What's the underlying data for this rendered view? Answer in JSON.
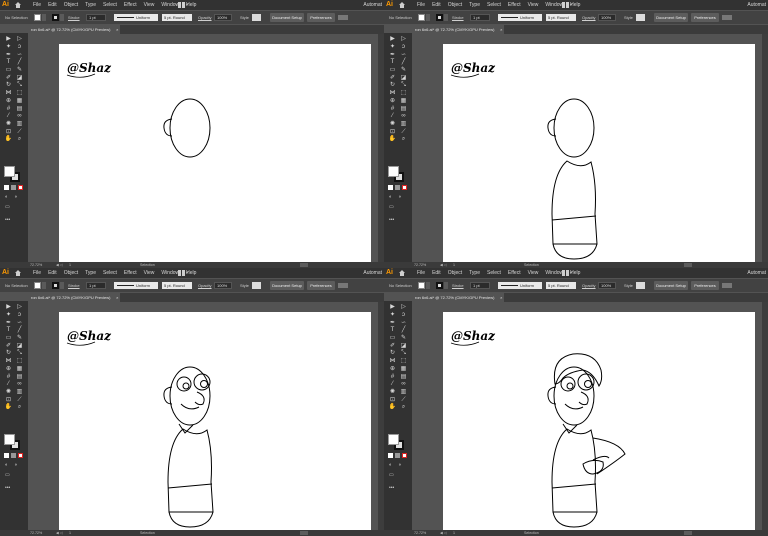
{
  "panels": [
    {
      "menubar": {
        "logo": "Ai",
        "menus": [
          "File",
          "Edit",
          "Object",
          "Type",
          "Select",
          "Effect",
          "View",
          "Window",
          "Help"
        ],
        "workspace": "Automat"
      },
      "control_bar": {
        "selection": "No Selection",
        "stroke_label": "Stroke",
        "stroke_weight": "1 pt",
        "profile": "Uniform",
        "brush": "5 pt. Round",
        "opacity_label": "Opacity",
        "opacity": "100%",
        "style_label": "Style",
        "doc_setup": "Document Setup",
        "preferences": "Preferences"
      },
      "tab": {
        "title": "ron 6x6.ai* @ 72.72% (CMYK/GPU Preview)",
        "close": "×"
      },
      "status": {
        "zoom": "72.72%",
        "page": "1",
        "mode": "Selection"
      },
      "signature": "@Shaz"
    },
    {
      "menubar": {
        "logo": "Ai",
        "menus": [
          "File",
          "Edit",
          "Object",
          "Type",
          "Select",
          "Effect",
          "View",
          "Window",
          "Help"
        ],
        "workspace": "Automat"
      },
      "control_bar": {
        "selection": "No Selection",
        "stroke_label": "Stroke",
        "stroke_weight": "1 pt",
        "profile": "Uniform",
        "brush": "5 pt. Round",
        "opacity_label": "Opacity",
        "opacity": "100%",
        "style_label": "Style",
        "doc_setup": "Document Setup",
        "preferences": "Preferences"
      },
      "tab": {
        "title": "ron 6x6.ai* @ 72.72% (CMYK/GPU Preview)",
        "close": "×"
      },
      "status": {
        "zoom": "72.72%",
        "page": "1",
        "mode": "Selection"
      },
      "signature": "@Shaz"
    },
    {
      "menubar": {
        "logo": "Ai",
        "menus": [
          "File",
          "Edit",
          "Object",
          "Type",
          "Select",
          "Effect",
          "View",
          "Window",
          "Help"
        ],
        "workspace": "Automat"
      },
      "control_bar": {
        "selection": "No Selection",
        "stroke_label": "Stroke",
        "stroke_weight": "1 pt",
        "profile": "Uniform",
        "brush": "5 pt. Round",
        "opacity_label": "Opacity",
        "opacity": "100%",
        "style_label": "Style",
        "doc_setup": "Document Setup",
        "preferences": "Preferences"
      },
      "tab": {
        "title": "ron 6x6.ai* @ 72.72% (CMYK/GPU Preview)",
        "close": "×"
      },
      "status": {
        "zoom": "72.72%",
        "page": "1",
        "mode": "Selection"
      },
      "signature": "@Shaz"
    },
    {
      "menubar": {
        "logo": "Ai",
        "menus": [
          "File",
          "Edit",
          "Object",
          "Type",
          "Select",
          "Effect",
          "View",
          "Window",
          "Help"
        ],
        "workspace": "Automat"
      },
      "control_bar": {
        "selection": "No Selection",
        "stroke_label": "Stroke",
        "stroke_weight": "1 pt",
        "profile": "Uniform",
        "brush": "5 pt. Round",
        "opacity_label": "Opacity",
        "opacity": "100%",
        "style_label": "Style",
        "doc_setup": "Document Setup",
        "preferences": "Preferences"
      },
      "tab": {
        "title": "ron 6x6.ai* @ 72.72% (CMYK/GPU Preview)",
        "close": "×"
      },
      "status": {
        "zoom": "72.72%",
        "page": "1",
        "mode": "Selection"
      },
      "signature": "@Shaz"
    }
  ],
  "tools": [
    {
      "icon": "selection-tool-icon",
      "glyph": "▶"
    },
    {
      "icon": "direct-selection-tool-icon",
      "glyph": "▷"
    },
    {
      "icon": "magic-wand-tool-icon",
      "glyph": "✦"
    },
    {
      "icon": "lasso-tool-icon",
      "glyph": "ↄ"
    },
    {
      "icon": "pen-tool-icon",
      "glyph": "✒"
    },
    {
      "icon": "curvature-tool-icon",
      "glyph": "∽"
    },
    {
      "icon": "type-tool-icon",
      "glyph": "T"
    },
    {
      "icon": "line-tool-icon",
      "glyph": "╱"
    },
    {
      "icon": "rectangle-tool-icon",
      "glyph": "▭"
    },
    {
      "icon": "paintbrush-tool-icon",
      "glyph": "✎"
    },
    {
      "icon": "shaper-tool-icon",
      "glyph": "✐"
    },
    {
      "icon": "eraser-tool-icon",
      "glyph": "◪"
    },
    {
      "icon": "rotate-tool-icon",
      "glyph": "↻"
    },
    {
      "icon": "scale-tool-icon",
      "glyph": "⤡"
    },
    {
      "icon": "width-tool-icon",
      "glyph": "⋈"
    },
    {
      "icon": "free-transform-tool-icon",
      "glyph": "⬚"
    },
    {
      "icon": "shape-builder-tool-icon",
      "glyph": "⊕"
    },
    {
      "icon": "perspective-grid-tool-icon",
      "glyph": "▦"
    },
    {
      "icon": "mesh-tool-icon",
      "glyph": "#"
    },
    {
      "icon": "gradient-tool-icon",
      "glyph": "▤"
    },
    {
      "icon": "eyedropper-tool-icon",
      "glyph": "⁄"
    },
    {
      "icon": "blend-tool-icon",
      "glyph": "∞"
    },
    {
      "icon": "symbol-sprayer-tool-icon",
      "glyph": "✺"
    },
    {
      "icon": "column-graph-tool-icon",
      "glyph": "▥"
    },
    {
      "icon": "artboard-tool-icon",
      "glyph": "⊡"
    },
    {
      "icon": "slice-tool-icon",
      "glyph": "⟋"
    },
    {
      "icon": "hand-tool-icon",
      "glyph": "✋"
    },
    {
      "icon": "zoom-tool-icon",
      "glyph": "⌕"
    }
  ],
  "colors": {
    "interface_bg": "#535353",
    "menubar_bg": "#323232",
    "artboard": "#ffffff",
    "ai_logo": "#ff9a00"
  }
}
